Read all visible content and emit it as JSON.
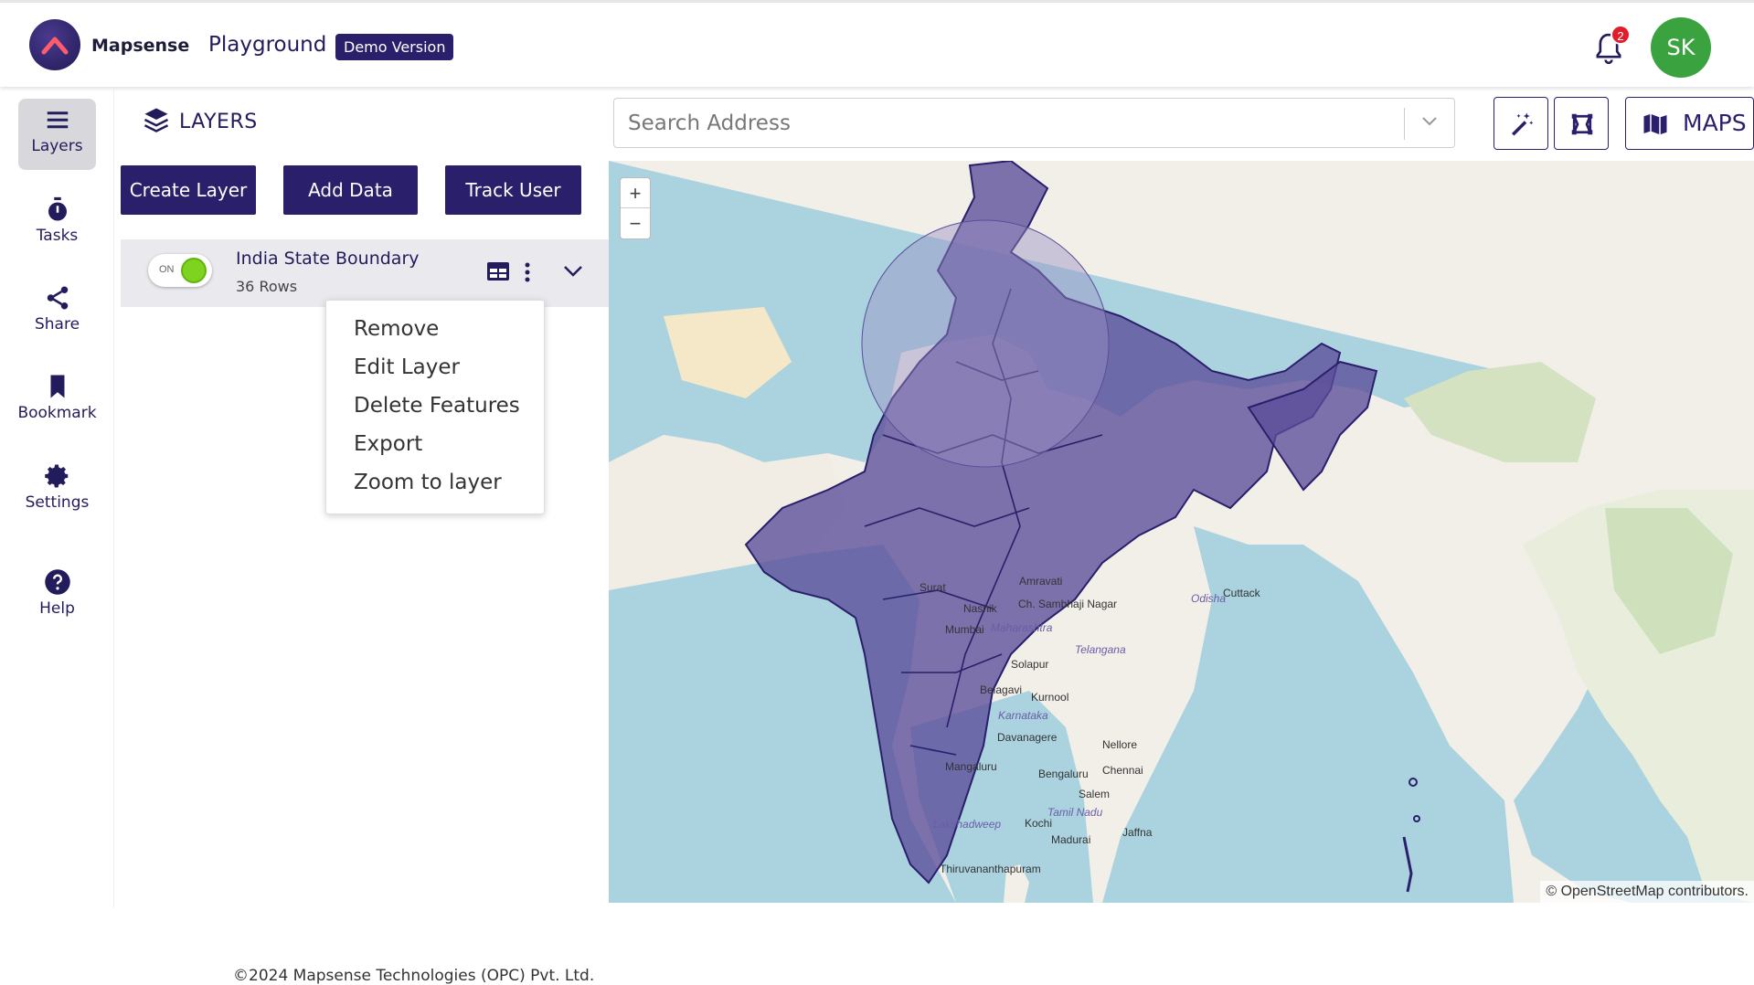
{
  "header": {
    "brand": "Mapsense",
    "app_title": "Playground",
    "badge": "Demo Version",
    "notification_count": "2",
    "avatar_initials": "SK",
    "colors": {
      "brand": "#2a1f6b",
      "avatar": "#3aa33f",
      "badge": "#e01e2b"
    }
  },
  "nav": {
    "items": [
      {
        "label": "Layers",
        "icon": "menu-icon",
        "active": true
      },
      {
        "label": "Tasks",
        "icon": "stopwatch-icon"
      },
      {
        "label": "Share",
        "icon": "share-icon"
      },
      {
        "label": "Bookmark",
        "icon": "bookmark-icon"
      },
      {
        "label": "Settings",
        "icon": "gear-icon"
      },
      {
        "label": "Help",
        "icon": "help-icon"
      }
    ]
  },
  "panel": {
    "title": "LAYERS",
    "buttons": {
      "create": "Create Layer",
      "add": "Add Data",
      "track": "Track User"
    },
    "layer": {
      "toggle": "ON",
      "name": "India State Boundary",
      "rows": "36 Rows"
    },
    "menu": [
      "Remove",
      "Edit Layer",
      "Delete Features",
      "Export",
      "Zoom to layer"
    ],
    "footer": "©2024 Mapsense Technologies (OPC) Pvt. Ltd."
  },
  "search": {
    "placeholder": "Search Address"
  },
  "toolbar": {
    "maps_label": "MAPS"
  },
  "map": {
    "zoom_in": "+",
    "zoom_out": "−",
    "attribution": "© OpenStreetMap contributors.",
    "labels": [
      "Surat",
      "Nashik",
      "Mumbai",
      "Amravati",
      "Ch. Sambhaji Nagar",
      "Maharashtra",
      "Telangana",
      "Cuttack",
      "Odisha",
      "Belagavi",
      "Karnataka",
      "Davanagere",
      "Mangaluru",
      "Bengaluru",
      "Chennai",
      "Nellore",
      "Kochi",
      "Madurai",
      "Tamil Nadu",
      "Thiruvananthapuram",
      "Jaffna",
      "Lakshadweep",
      "Salem",
      "Solapur",
      "Kurnool"
    ],
    "colors": {
      "water": "#aad3df",
      "land": "#f2efe9",
      "overlay": "#5b4d9a"
    }
  }
}
